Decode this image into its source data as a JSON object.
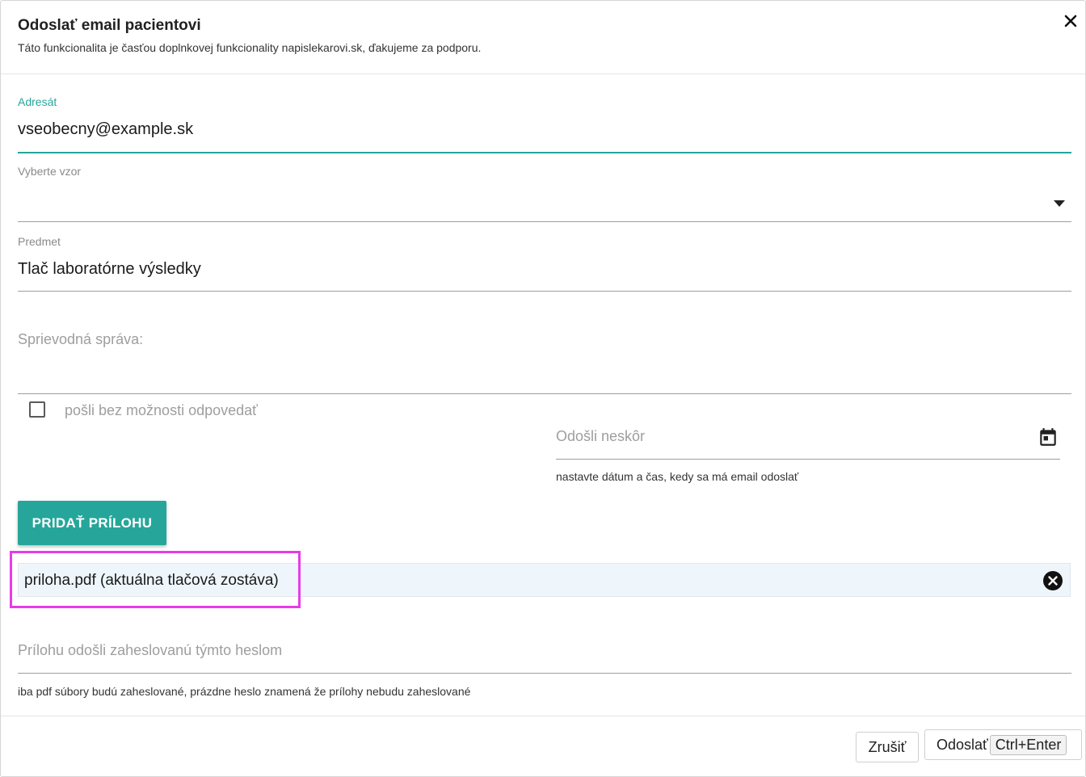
{
  "dialog": {
    "title": "Odoslať email pacientovi",
    "subtitle": "Táto funkcionalita je časťou doplnkovej funkcionality napislekarovi.sk, ďakujeme za podporu.",
    "close_icon": "close-icon"
  },
  "recipient": {
    "label": "Adresát",
    "value": "vseobecny@example.sk"
  },
  "template": {
    "label": "Vyberte vzor",
    "value": "",
    "icon": "caret-down-icon"
  },
  "subject": {
    "label": "Predmet",
    "value": "Tlač laboratórne výsledky"
  },
  "message": {
    "placeholder": "Sprievodná správa:"
  },
  "no_reply": {
    "label": "pošli bez možnosti odpovedať",
    "checked": false
  },
  "send_later": {
    "placeholder": "Odošli neskôr",
    "help": "nastavte dátum a čas, kedy sa má email odoslať",
    "icon": "calendar-icon"
  },
  "add_attachment": {
    "label": "PRIDAŤ PRÍLOHU"
  },
  "attachments": [
    {
      "name": "priloha.pdf (aktuálna tlačová zostáva)",
      "remove_icon": "remove-circle-icon"
    }
  ],
  "password": {
    "placeholder": "Prílohu odošli zaheslovanú týmto heslom",
    "help": "iba pdf súbory budú zaheslované, prázdne heslo znamená že prílohy nebudu zaheslované"
  },
  "footer": {
    "cancel_label": "Zrušiť",
    "send_label": "Odoslať",
    "send_shortcut": "Ctrl+Enter"
  },
  "colors": {
    "accent": "#26a69a",
    "highlight": "#e83be8",
    "attachment_bg": "#eef6fc"
  }
}
